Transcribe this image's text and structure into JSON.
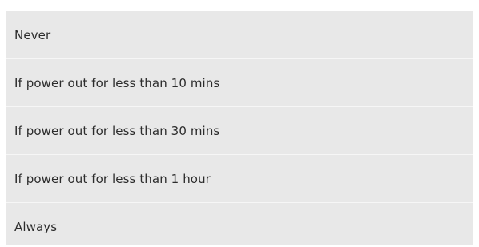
{
  "options_list": {
    "items": [
      {
        "label": "Never"
      },
      {
        "label": "If power out for less than 10 mins"
      },
      {
        "label": "If power out for less than 30 mins"
      },
      {
        "label": "If power out for less than 1 hour"
      },
      {
        "label": "Always"
      }
    ]
  },
  "colors": {
    "item_background": "#e8e8e8",
    "divider": "#f6f6f6",
    "text": "#2c2c2c"
  }
}
